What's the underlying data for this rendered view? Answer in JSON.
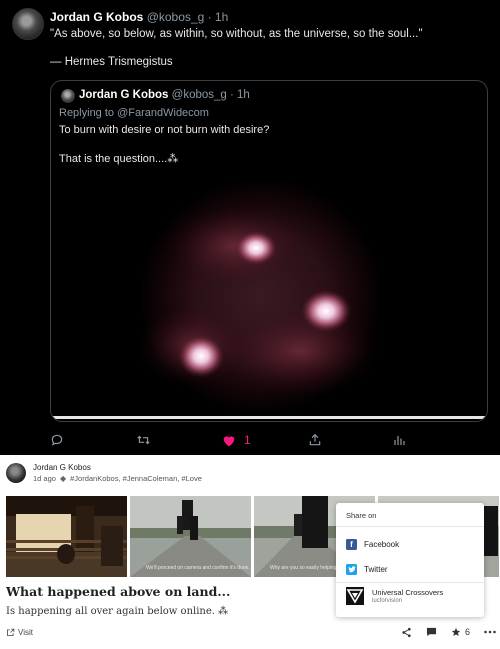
{
  "tweet": {
    "name": "Jordan G Kobos",
    "meta": "@kobos_g · 1h",
    "text": "\"As above, so below, as within, so without, as the universe, so the soul...\"",
    "attribution": "— Hermes Trismegistus"
  },
  "quoted": {
    "name": "Jordan G Kobos",
    "meta": "@kobos_g · 1h",
    "replying_prefix": "Replying to ",
    "replying_to": "@FarandWidecom",
    "line1": "To burn with desire or not burn with desire?",
    "line2": "That is the question....⁂"
  },
  "tweet_actions": {
    "like_count": "1",
    "like_color": "#f91880",
    "icons": [
      "reply-icon",
      "retweet-icon",
      "like-icon",
      "share-icon",
      "analytics-icon"
    ]
  },
  "post": {
    "author": "Jordan G Kobos",
    "age": "1d ago",
    "tags": "#JordanKobos, #JennaColeman, #Love",
    "thumb_captions": [
      "",
      "We'll proceed on camera and confirm it's done.",
      "Why are you so easily helping us?",
      ""
    ],
    "title": "What happened above on land...",
    "description": "Is happening all over again below online. ⁂",
    "visit_label": "Visit",
    "star_count": "6"
  },
  "share_menu": {
    "title": "Share on",
    "items": [
      {
        "label": "Facebook",
        "icon": "facebook-icon",
        "color": "#3b5998"
      },
      {
        "label": "Twitter",
        "icon": "twitter-icon",
        "color": "#1da1f2"
      }
    ],
    "community_name": "Universal Crossovers",
    "community_sub": "lucforvision"
  }
}
